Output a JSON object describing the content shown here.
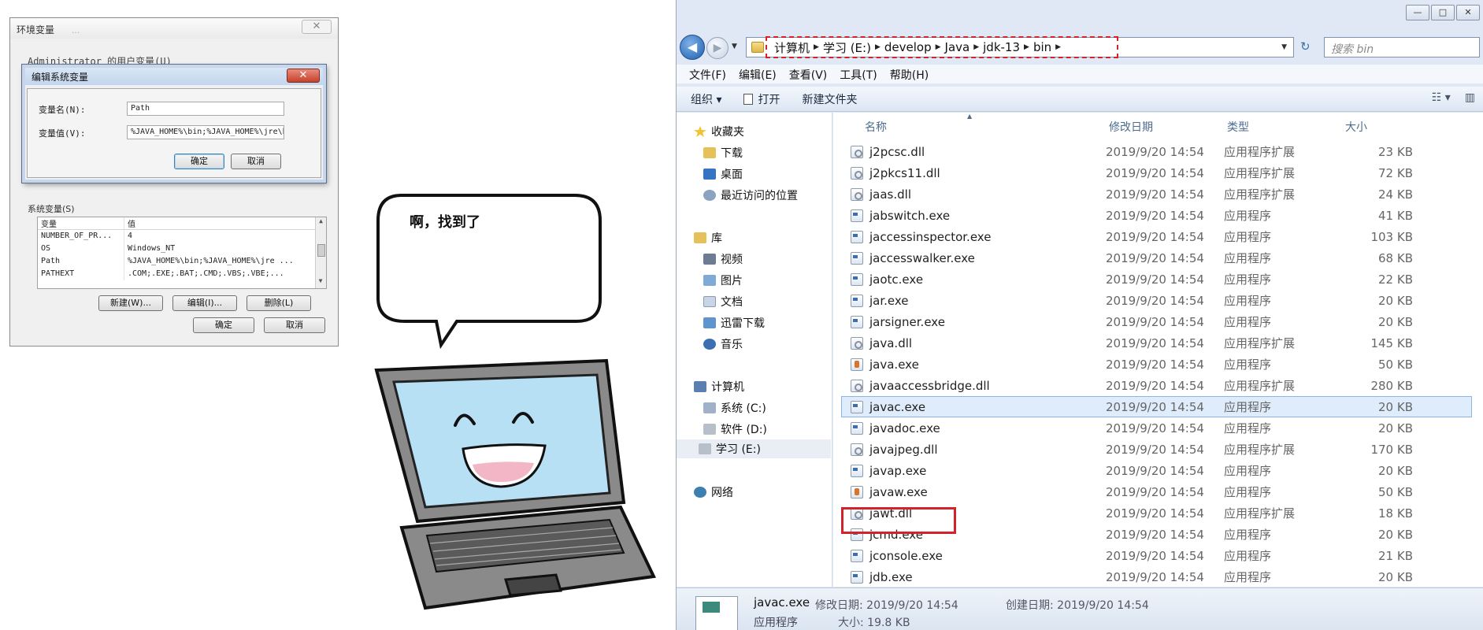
{
  "env_dialog": {
    "title": "环境变量",
    "title_blur": "...",
    "close_glyph": "✕",
    "user_vars_label": "Administrator 的用户变量(U)",
    "system_vars_label": "系统变量(S)",
    "system_vars_columns": [
      "变量",
      "值"
    ],
    "system_vars_rows": [
      {
        "name": "NUMBER_OF_PR...",
        "value": "4"
      },
      {
        "name": "OS",
        "value": "Windows_NT"
      },
      {
        "name": "Path",
        "value": "%JAVA_HOME%\\bin;%JAVA_HOME%\\jre ..."
      },
      {
        "name": "PATHEXT",
        "value": ".COM;.EXE;.BAT;.CMD;.VBS;.VBE;..."
      }
    ],
    "new_button": "新建(W)...",
    "edit_button": "编辑(I)...",
    "delete_button": "删除(L)",
    "ok_button": "确定",
    "cancel_button": "取消"
  },
  "edit_dialog": {
    "title": "编辑系统变量",
    "close_glyph": "✕",
    "var_name_label": "变量名(N):",
    "var_name_value": "Path",
    "var_value_label": "变量值(V):",
    "var_value_value": "%JAVA_HOME%\\bin;%JAVA_HOME%\\jre\\bin;",
    "ok_button": "确定",
    "cancel_button": "取消"
  },
  "cartoon": {
    "speech_text": "啊，找到了"
  },
  "explorer": {
    "window_controls": [
      "—",
      "□",
      "✕"
    ],
    "back_glyph": "◀",
    "forward_glyph": "▶",
    "breadcrumb": [
      "计算机",
      "学习 (E:)",
      "develop",
      "Java",
      "jdk-13",
      "bin"
    ],
    "crumb_sep": "▶",
    "dropdown_glyph": "▼",
    "refresh_glyph": "↻",
    "search_placeholder": "搜索 bin",
    "menu": [
      "文件(F)",
      "编辑(E)",
      "查看(V)",
      "工具(T)",
      "帮助(H)"
    ],
    "commands": {
      "organize": "组织 ▾",
      "open": "打开",
      "new_folder": "新建文件夹"
    },
    "view_glyphs": [
      "☷ ▾",
      "▥"
    ],
    "nav": {
      "favorites": "收藏夹",
      "downloads": "下载",
      "desktop": "桌面",
      "recent": "最近访问的位置",
      "libraries": "库",
      "videos": "视频",
      "pictures": "图片",
      "documents": "文档",
      "xunlei": "迅雷下载",
      "music": "音乐",
      "computer": "计算机",
      "drive_c": "系统 (C:)",
      "drive_d": "软件 (D:)",
      "drive_e": "学习 (E:)",
      "network": "网络"
    },
    "columns": {
      "name": "名称",
      "date": "修改日期",
      "type": "类型",
      "size": "大小",
      "sort_glyph": "▲"
    },
    "files": [
      {
        "name": "j2pcsc.dll",
        "date": "2019/9/20 14:54",
        "type": "应用程序扩展",
        "size": "23 KB",
        "icon": "dll"
      },
      {
        "name": "j2pkcs11.dll",
        "date": "2019/9/20 14:54",
        "type": "应用程序扩展",
        "size": "72 KB",
        "icon": "dll"
      },
      {
        "name": "jaas.dll",
        "date": "2019/9/20 14:54",
        "type": "应用程序扩展",
        "size": "24 KB",
        "icon": "dll"
      },
      {
        "name": "jabswitch.exe",
        "date": "2019/9/20 14:54",
        "type": "应用程序",
        "size": "41 KB",
        "icon": "exe"
      },
      {
        "name": "jaccessinspector.exe",
        "date": "2019/9/20 14:54",
        "type": "应用程序",
        "size": "103 KB",
        "icon": "exe"
      },
      {
        "name": "jaccesswalker.exe",
        "date": "2019/9/20 14:54",
        "type": "应用程序",
        "size": "68 KB",
        "icon": "exe"
      },
      {
        "name": "jaotc.exe",
        "date": "2019/9/20 14:54",
        "type": "应用程序",
        "size": "22 KB",
        "icon": "exe"
      },
      {
        "name": "jar.exe",
        "date": "2019/9/20 14:54",
        "type": "应用程序",
        "size": "20 KB",
        "icon": "exe"
      },
      {
        "name": "jarsigner.exe",
        "date": "2019/9/20 14:54",
        "type": "应用程序",
        "size": "20 KB",
        "icon": "exe"
      },
      {
        "name": "java.dll",
        "date": "2019/9/20 14:54",
        "type": "应用程序扩展",
        "size": "145 KB",
        "icon": "dll"
      },
      {
        "name": "java.exe",
        "date": "2019/9/20 14:54",
        "type": "应用程序",
        "size": "50 KB",
        "icon": "java"
      },
      {
        "name": "javaaccessbridge.dll",
        "date": "2019/9/20 14:54",
        "type": "应用程序扩展",
        "size": "280 KB",
        "icon": "dll"
      },
      {
        "name": "javac.exe",
        "date": "2019/9/20 14:54",
        "type": "应用程序",
        "size": "20 KB",
        "icon": "exe",
        "selected": true
      },
      {
        "name": "javadoc.exe",
        "date": "2019/9/20 14:54",
        "type": "应用程序",
        "size": "20 KB",
        "icon": "exe"
      },
      {
        "name": "javajpeg.dll",
        "date": "2019/9/20 14:54",
        "type": "应用程序扩展",
        "size": "170 KB",
        "icon": "dll"
      },
      {
        "name": "javap.exe",
        "date": "2019/9/20 14:54",
        "type": "应用程序",
        "size": "20 KB",
        "icon": "exe"
      },
      {
        "name": "javaw.exe",
        "date": "2019/9/20 14:54",
        "type": "应用程序",
        "size": "50 KB",
        "icon": "java"
      },
      {
        "name": "jawt.dll",
        "date": "2019/9/20 14:54",
        "type": "应用程序扩展",
        "size": "18 KB",
        "icon": "dll"
      },
      {
        "name": "jcmd.exe",
        "date": "2019/9/20 14:54",
        "type": "应用程序",
        "size": "20 KB",
        "icon": "exe"
      },
      {
        "name": "jconsole.exe",
        "date": "2019/9/20 14:54",
        "type": "应用程序",
        "size": "21 KB",
        "icon": "exe"
      },
      {
        "name": "jdb.exe",
        "date": "2019/9/20 14:54",
        "type": "应用程序",
        "size": "20 KB",
        "icon": "exe"
      }
    ],
    "details": {
      "name": "javac.exe",
      "type": "应用程序",
      "modified": "修改日期: 2019/9/20 14:54",
      "size": "大小: 19.8 KB",
      "created": "创建日期: 2019/9/20 14:54"
    },
    "colors": {
      "highlight_red": "#d3232a",
      "selection_blue": "#dfecfb"
    }
  }
}
